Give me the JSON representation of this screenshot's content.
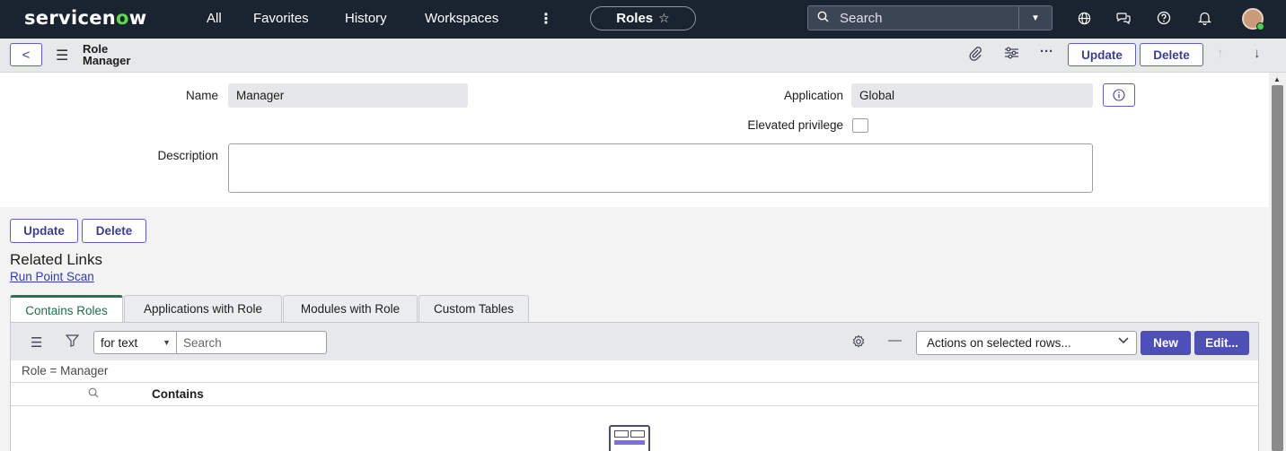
{
  "topnav": {
    "logo": {
      "pre": "servicen",
      "o": "o",
      "post": "w"
    },
    "links": [
      "All",
      "Favorites",
      "History",
      "Workspaces"
    ],
    "context_pill": {
      "label": "Roles"
    },
    "search": {
      "placeholder": "Search"
    }
  },
  "form_header": {
    "title_line1": "Role",
    "title_line2": "Manager",
    "update_label": "Update",
    "delete_label": "Delete"
  },
  "form": {
    "name_label": "Name",
    "name_value": "Manager",
    "application_label": "Application",
    "application_value": "Global",
    "elevated_label": "Elevated privilege",
    "elevated_checked": false,
    "description_label": "Description",
    "description_value": ""
  },
  "bottom_buttons": {
    "update_label": "Update",
    "delete_label": "Delete"
  },
  "related_links": {
    "title": "Related Links",
    "links": [
      "Run Point Scan"
    ]
  },
  "tabs": [
    {
      "label": "Contains Roles",
      "active": true
    },
    {
      "label": "Applications with Role",
      "active": false
    },
    {
      "label": "Modules with Role",
      "active": false
    },
    {
      "label": "Custom Tables",
      "active": false
    }
  ],
  "list": {
    "search_field_option": "for text",
    "search_placeholder": "Search",
    "actions_placeholder": "Actions on selected rows...",
    "new_label": "New",
    "edit_label": "Edit...",
    "breadcrumb": "Role = Manager",
    "column_header": "Contains"
  },
  "colors": {
    "nav_bg": "#1a2330",
    "primary": "#4e50b8",
    "active_tab": "#1f7a52",
    "logo_accent": "#62d84e"
  }
}
